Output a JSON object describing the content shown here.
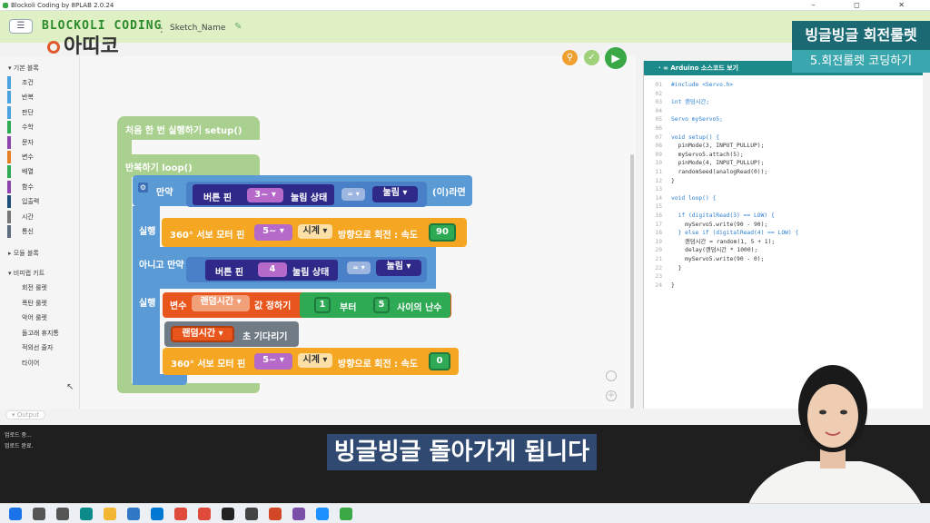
{
  "window": {
    "title": "Blockoli Coding by 8PLAB 2.0.24",
    "controls": "–  ◻  ✕"
  },
  "topbar": {
    "menu_icon": "list-icon",
    "logo": "BLOCKOLI CODING",
    "sep": ":",
    "sketch_name": "Sketch_Name",
    "channel_logo": "아띠코"
  },
  "sidebar": {
    "basic_head": "기본 블록",
    "categories": [
      {
        "label": "조건",
        "color": "#4aa3df"
      },
      {
        "label": "반복",
        "color": "#4aa3df"
      },
      {
        "label": "판단",
        "color": "#4aa3df"
      },
      {
        "label": "수학",
        "color": "#2eaa55"
      },
      {
        "label": "문자",
        "color": "#8e44ad"
      },
      {
        "label": "변수",
        "color": "#e67e22"
      },
      {
        "label": "배열",
        "color": "#2eaa55"
      },
      {
        "label": "함수",
        "color": "#8e44ad"
      },
      {
        "label": "입출력",
        "color": "#1f4e79"
      },
      {
        "label": "시간",
        "color": "#777777"
      },
      {
        "label": "통신",
        "color": "#5d6d7e"
      }
    ],
    "module_head": "모듈 블록",
    "kit_head": "비피랩 키트",
    "kit_items": [
      "회전 룰렛",
      "폭탄 룰렛",
      "악어 룰렛",
      "돌고래 휴지통",
      "적외선 줄자",
      "타이어"
    ]
  },
  "workspace": {
    "setup_label": "처음 한 번 실행하기 setup()",
    "loop_label": "반복하기 loop()",
    "if_label": "만약",
    "button_pin": "버튼 핀",
    "pin3": "3~",
    "pressed_state": "눌림 상태",
    "eq": "=",
    "pressed": "눌림",
    "then": "(이)라면",
    "do": "실행",
    "servo360": "360° 서보 모터 핀",
    "pin5": "5~",
    "clockwise": "시계",
    "rotate_speed": "방향으로 회전 : 속도",
    "speed1": "90",
    "elseif": "아니고 만약",
    "pin4": "4",
    "var_label": "변수",
    "var_name": "랜덤시간",
    "set_value": "값 정하기",
    "rand_from": "1",
    "rand_to_label": "부터",
    "rand_to": "5",
    "rand_between": "사이의 난수",
    "wait_label": "초 기다리기",
    "speed2": "0",
    "btn_search": "search-icon",
    "btn_verify": "check-icon",
    "btn_upload": "play-icon"
  },
  "code": {
    "header": "Arduino 소스코드 보기",
    "lines": [
      {
        "n": "01",
        "t": "#include <Servo.h>",
        "c": "#2a7fd4"
      },
      {
        "n": "02",
        "t": "",
        "c": "#333"
      },
      {
        "n": "03",
        "t": "int 랜덤시간;",
        "c": "#2a7fd4"
      },
      {
        "n": "04",
        "t": "",
        "c": "#333"
      },
      {
        "n": "05",
        "t": "Servo myServo5;",
        "c": "#2a7fd4"
      },
      {
        "n": "06",
        "t": "",
        "c": "#333"
      },
      {
        "n": "07",
        "t": "void setup() {",
        "c": "#2a7fd4"
      },
      {
        "n": "08",
        "t": "  pinMode(3, INPUT_PULLUP);",
        "c": "#333"
      },
      {
        "n": "09",
        "t": "  myServo5.attach(5);",
        "c": "#333"
      },
      {
        "n": "10",
        "t": "  pinMode(4, INPUT_PULLUP);",
        "c": "#333"
      },
      {
        "n": "11",
        "t": "  randomSeed(analogRead(0));",
        "c": "#333"
      },
      {
        "n": "12",
        "t": "}",
        "c": "#333"
      },
      {
        "n": "13",
        "t": "",
        "c": "#333"
      },
      {
        "n": "14",
        "t": "void loop() {",
        "c": "#2a7fd4"
      },
      {
        "n": "15",
        "t": "",
        "c": "#333"
      },
      {
        "n": "16",
        "t": "  if (digitalRead(3) == LOW) {",
        "c": "#2a7fd4"
      },
      {
        "n": "17",
        "t": "    myServo5.write(90 - 90);",
        "c": "#333"
      },
      {
        "n": "18",
        "t": "  } else if (digitalRead(4) == LOW) {",
        "c": "#2a7fd4"
      },
      {
        "n": "19",
        "t": "    랜덤시간 = random(1, 5 + 1);",
        "c": "#333"
      },
      {
        "n": "20",
        "t": "    delay(랜덤시간 * 1000);",
        "c": "#333"
      },
      {
        "n": "21",
        "t": "    myServo5.write(90 - 0);",
        "c": "#333"
      },
      {
        "n": "22",
        "t": "  }",
        "c": "#333"
      },
      {
        "n": "23",
        "t": "",
        "c": "#333"
      },
      {
        "n": "24",
        "t": "}",
        "c": "#333"
      }
    ]
  },
  "output": {
    "tab": "Output",
    "lines": [
      "업로드 중...",
      "업로드 완료."
    ]
  },
  "subtitle": "빙글빙글 돌아가게 됩니다",
  "topic": {
    "title": "빙글빙글 회전룰렛",
    "subtitle": "5.회전룰렛 코딩하기"
  },
  "taskbar": {
    "icons": [
      "windows-icon",
      "search-icon",
      "taskview-icon",
      "edge-icon",
      "folder-icon",
      "mail-icon",
      "store-icon",
      "chrome-icon",
      "chrome-icon",
      "app-icon",
      "settings-icon",
      "powerpoint-icon",
      "paint-icon",
      "media-icon",
      "blockoli-icon"
    ]
  }
}
